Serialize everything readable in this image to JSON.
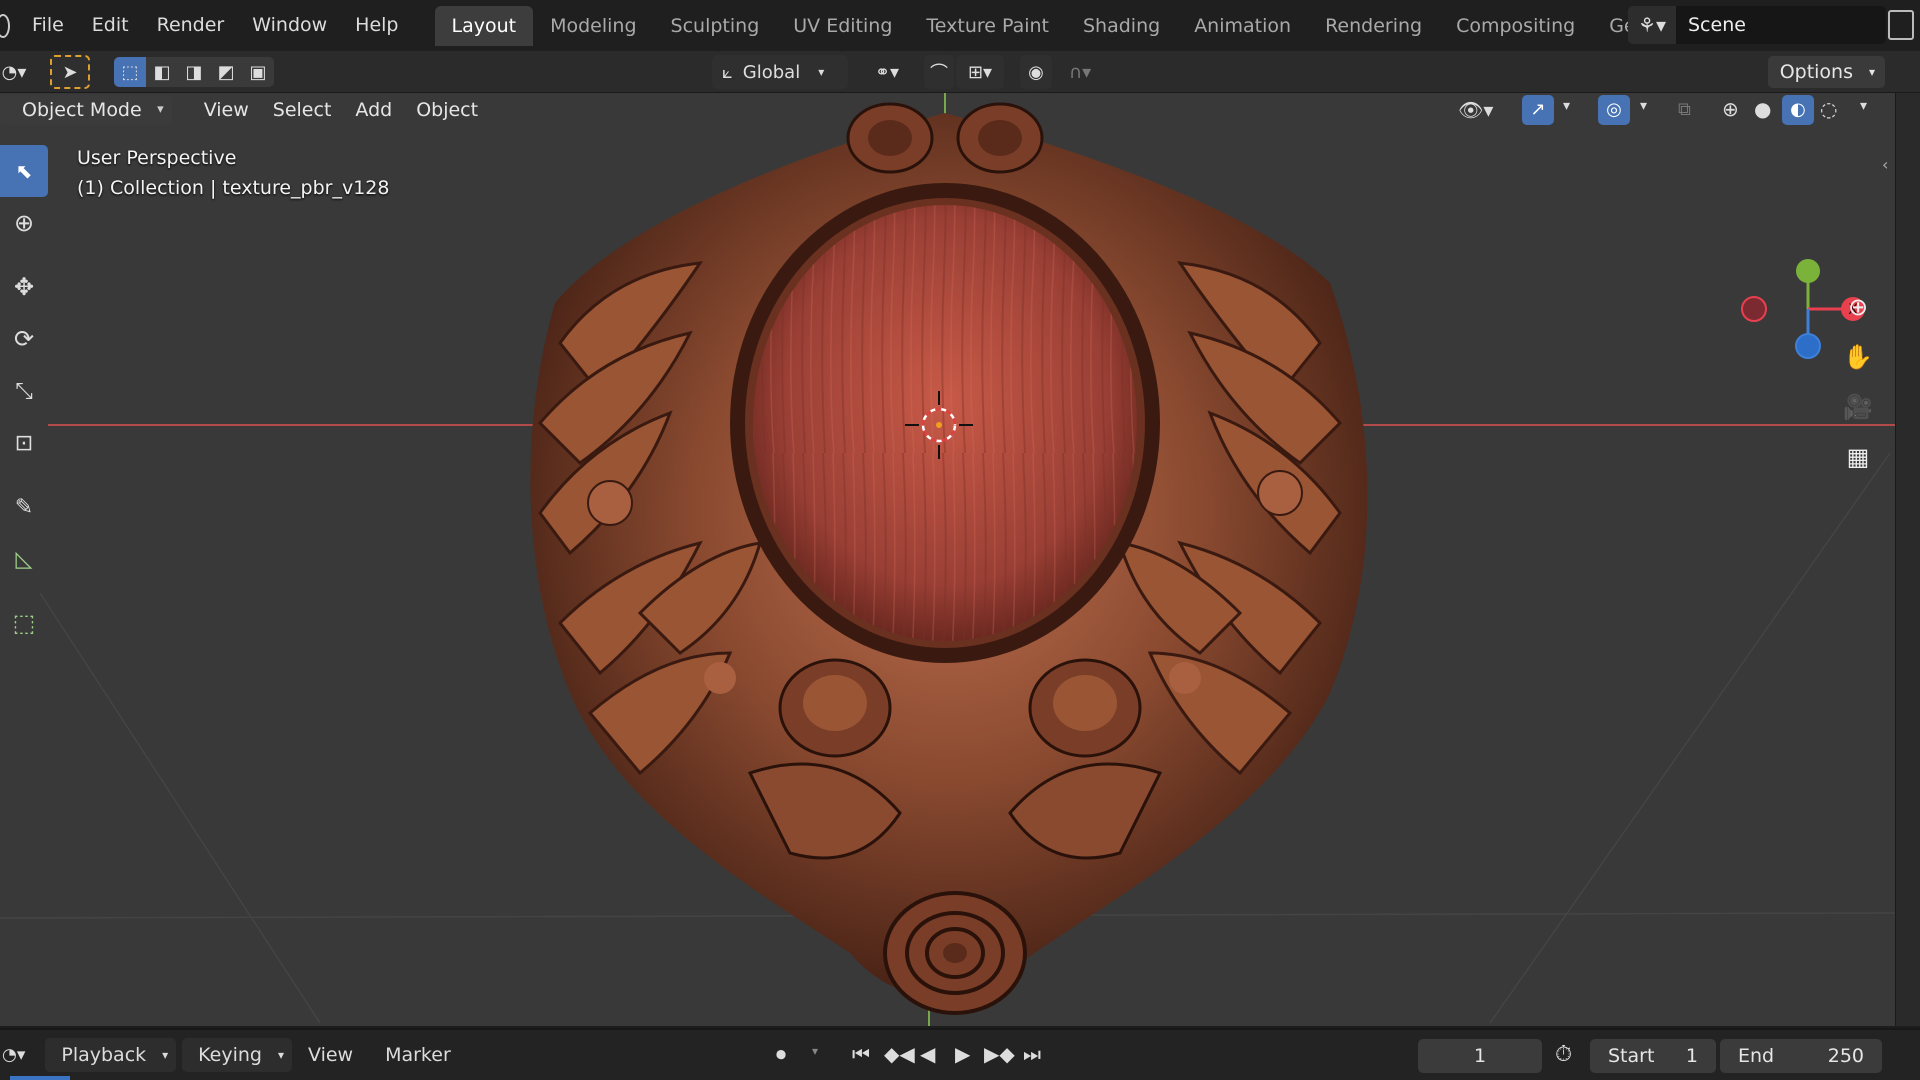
{
  "menu": [
    "File",
    "Edit",
    "Render",
    "Window",
    "Help"
  ],
  "workspaces": [
    "Layout",
    "Modeling",
    "Sculpting",
    "UV Editing",
    "Texture Paint",
    "Shading",
    "Animation",
    "Rendering",
    "Compositing",
    "Geometry Nod"
  ],
  "active_workspace": "Layout",
  "scene": {
    "label": "Scene"
  },
  "tool_header": {
    "orientation": "Global",
    "options_label": "Options"
  },
  "viewport_header": {
    "mode": "Object Mode",
    "menus": [
      "View",
      "Select",
      "Add",
      "Object"
    ]
  },
  "overlay": {
    "perspective": "User Perspective",
    "collection": "(1) Collection | texture_pbr_v128"
  },
  "gizmo_axes": {
    "x": "X",
    "x_color": "#e8404f",
    "y_color": "#7bb33a",
    "z_color": "#3d80d8"
  },
  "timeline": {
    "menus": [
      "Playback",
      "Keying",
      "View",
      "Marker"
    ],
    "current_frame": "1",
    "start_label": "Start",
    "start_value": "1",
    "end_label": "End",
    "end_value": "250"
  },
  "colors": {
    "accent": "#4772b3",
    "x_axis_line": "#b24a4a",
    "y_axis_line": "#78a84a",
    "wood_dark": "#3a1a10",
    "wood_light": "#b86a45"
  }
}
